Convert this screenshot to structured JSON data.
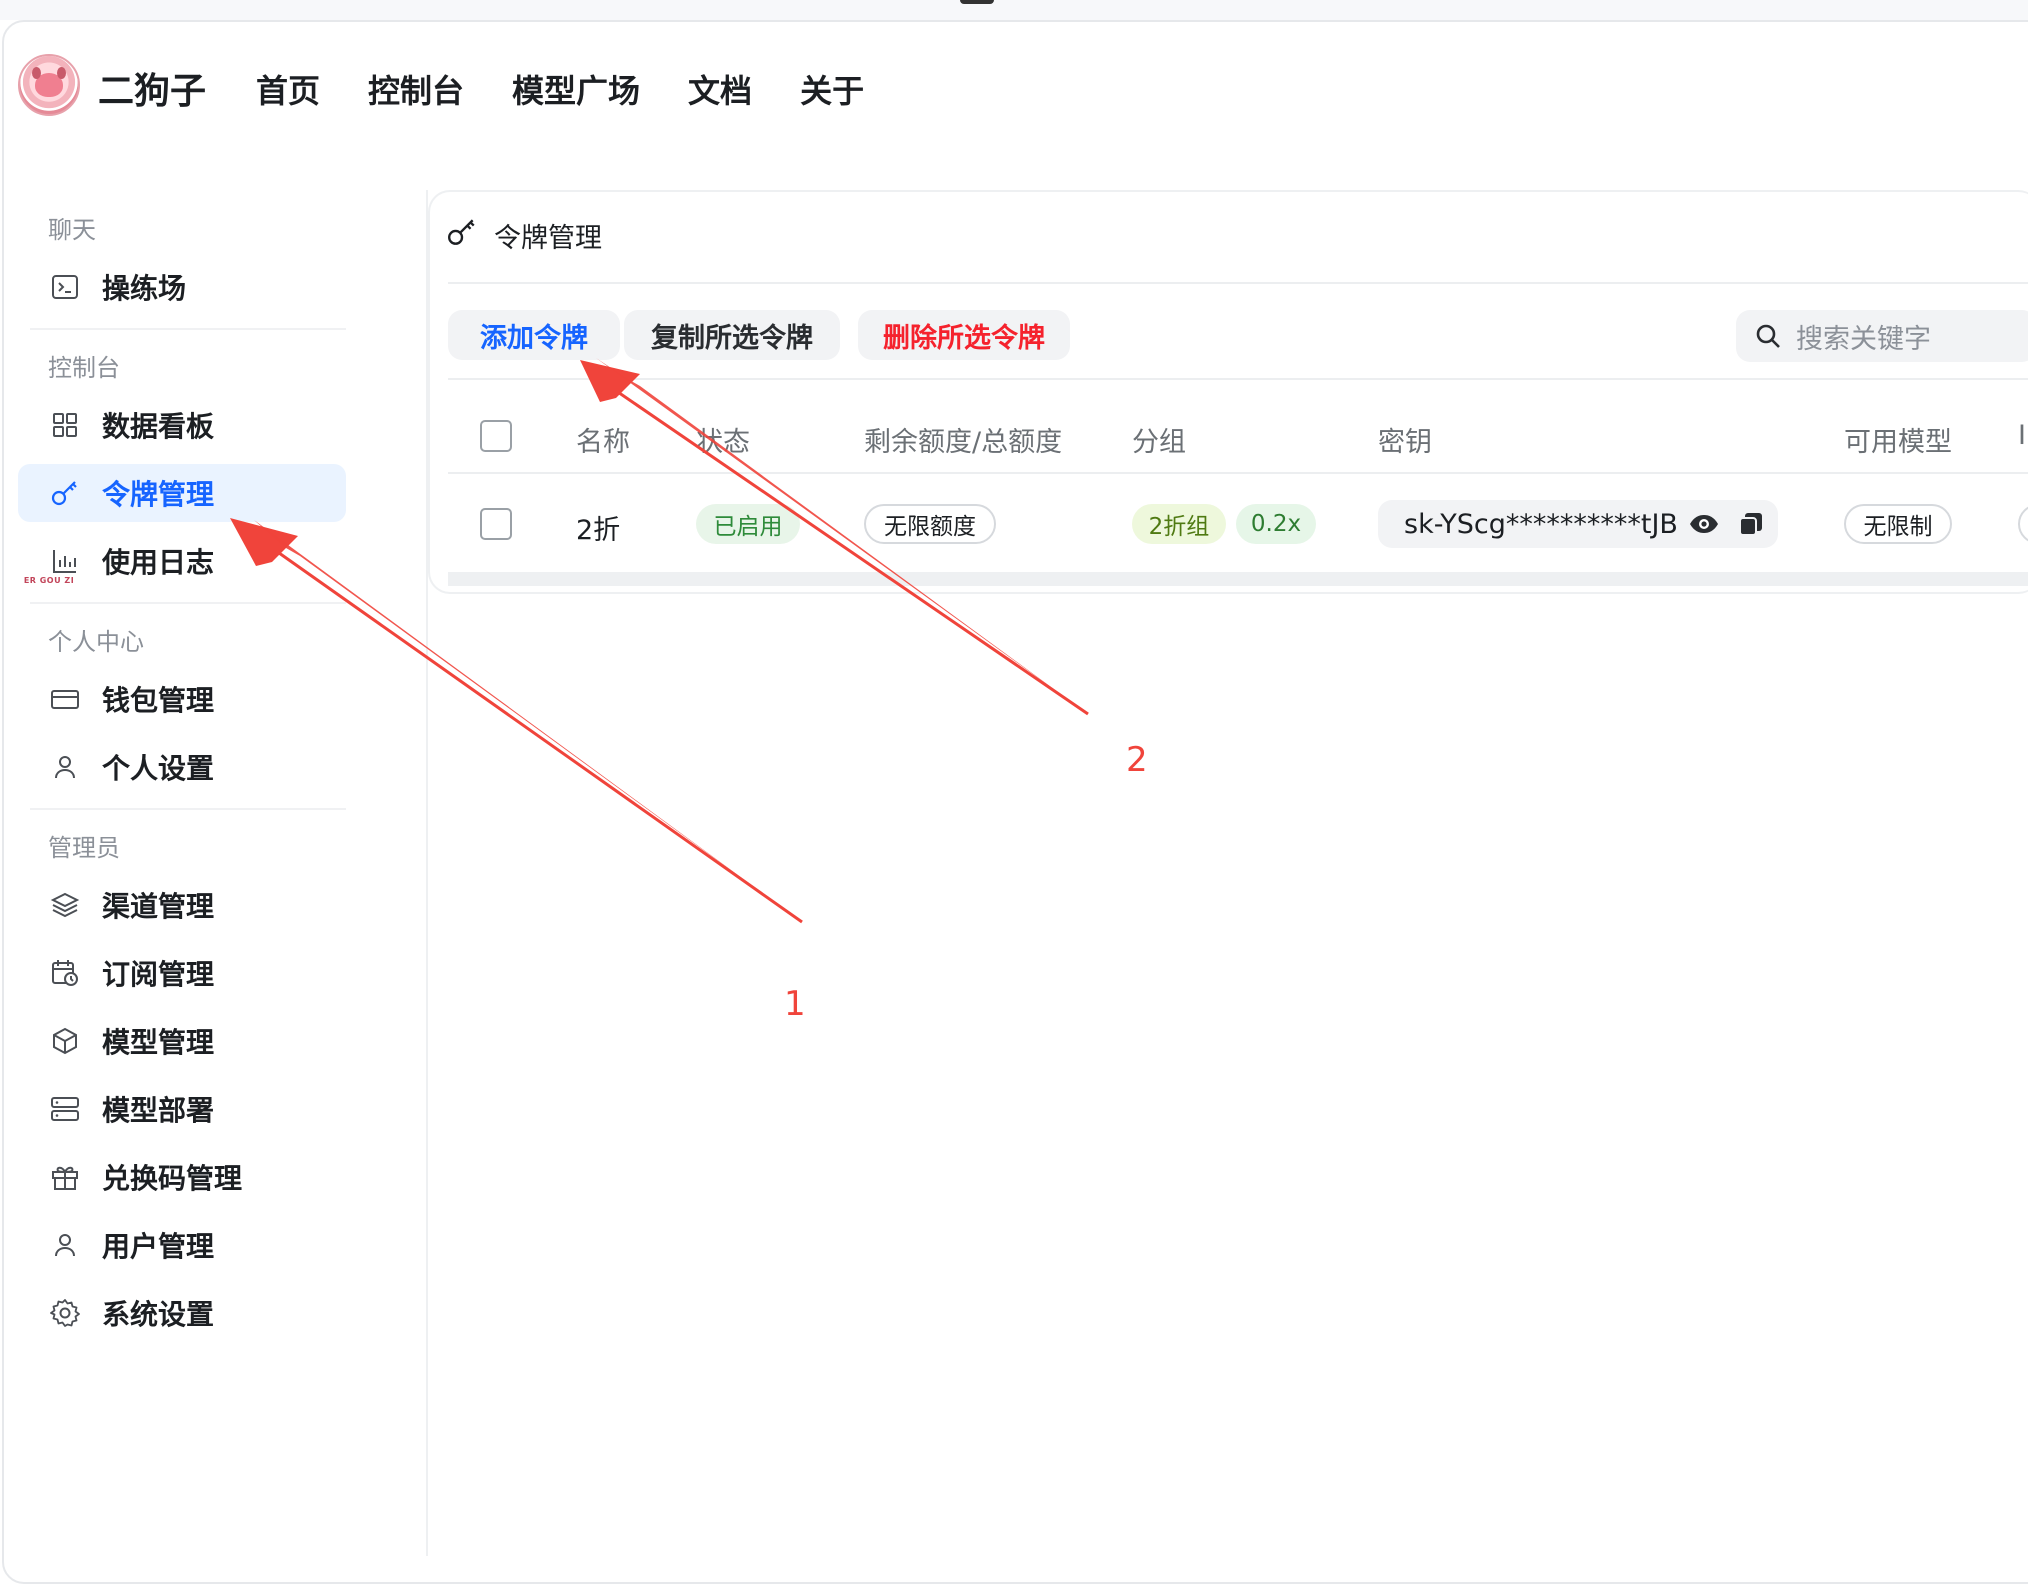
{
  "header": {
    "brand": "二狗子",
    "logo_text": "ER GOU ZI",
    "nav": [
      "首页",
      "控制台",
      "模型广场",
      "文档",
      "关于"
    ]
  },
  "sidebar": {
    "sections": [
      {
        "title": "聊天",
        "items": [
          {
            "label": "操练场",
            "icon": "terminal-icon"
          }
        ]
      },
      {
        "title": "控制台",
        "items": [
          {
            "label": "数据看板",
            "icon": "dashboard-icon"
          },
          {
            "label": "令牌管理",
            "icon": "key-icon",
            "active": true
          },
          {
            "label": "使用日志",
            "icon": "bar-chart-icon"
          }
        ]
      },
      {
        "title": "个人中心",
        "items": [
          {
            "label": "钱包管理",
            "icon": "wallet-icon"
          },
          {
            "label": "个人设置",
            "icon": "user-icon"
          }
        ]
      },
      {
        "title": "管理员",
        "items": [
          {
            "label": "渠道管理",
            "icon": "layers-icon"
          },
          {
            "label": "订阅管理",
            "icon": "calendar-clock-icon"
          },
          {
            "label": "模型管理",
            "icon": "cube-icon"
          },
          {
            "label": "模型部署",
            "icon": "server-icon"
          },
          {
            "label": "兑换码管理",
            "icon": "gift-icon"
          },
          {
            "label": "用户管理",
            "icon": "user-icon"
          },
          {
            "label": "系统设置",
            "icon": "gear-icon"
          }
        ]
      }
    ]
  },
  "main": {
    "title": "令牌管理",
    "toolbar": {
      "add_label": "添加令牌",
      "copy_label": "复制所选令牌",
      "delete_label": "删除所选令牌",
      "search_placeholder": "搜索关键字"
    },
    "table": {
      "columns": [
        "名称",
        "状态",
        "剩余额度/总额度",
        "分组",
        "密钥",
        "可用模型",
        "I"
      ],
      "rows": [
        {
          "name": "2折",
          "status": "已启用",
          "quota": "无限额度",
          "group": "2折组",
          "ratio": "0.2x",
          "key": "sk-YScg**********tJB",
          "models": "无限制"
        }
      ]
    }
  },
  "annotations": [
    "1",
    "2"
  ],
  "colors": {
    "accent": "#1664ff",
    "danger": "#f5222d",
    "annotation": "#f0443b",
    "active_bg": "#eaf3ff"
  }
}
